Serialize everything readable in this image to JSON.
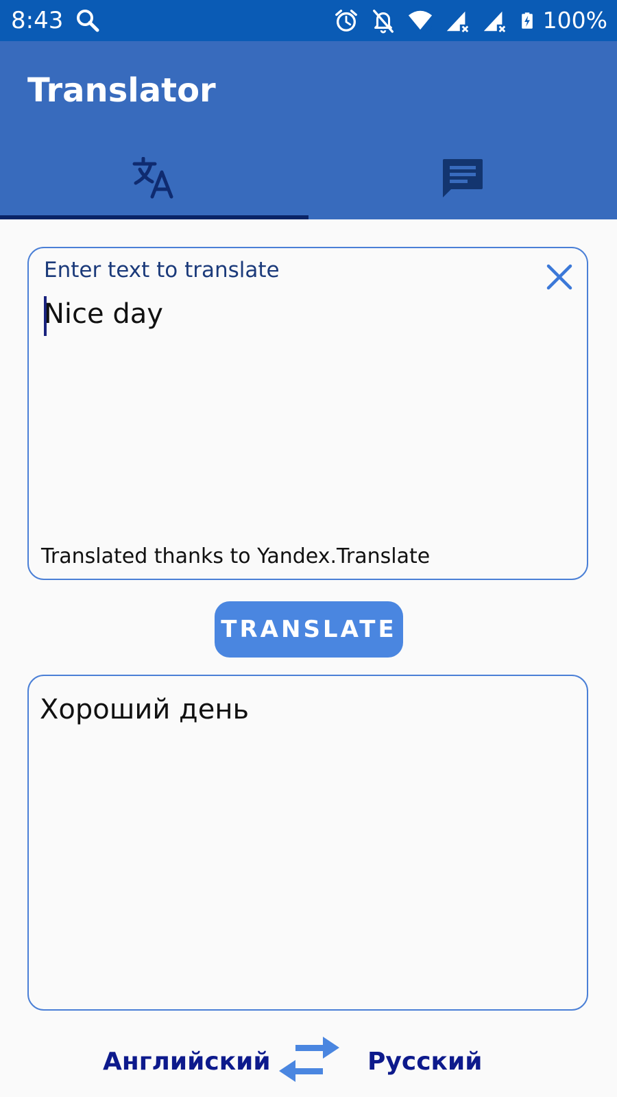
{
  "status_bar": {
    "time": "8:43",
    "battery_percent": "100%",
    "icons": [
      "search-icon",
      "alarm-icon",
      "notifications-off-icon",
      "wifi-icon",
      "signal-icon",
      "signal-icon",
      "battery-charging-icon"
    ]
  },
  "app_bar": {
    "title": "Translator"
  },
  "tabs": [
    {
      "icon": "translate-icon",
      "selected": true
    },
    {
      "icon": "chat-icon",
      "selected": false
    }
  ],
  "input": {
    "label": "Enter text to translate",
    "value": "Nice day",
    "credit": "Translated thanks to Yandex.Translate"
  },
  "translate_button": {
    "label": "TRANSLATE"
  },
  "output": {
    "value": "Хороший день"
  },
  "languages": {
    "source": "Английский",
    "target": "Русский"
  },
  "colors": {
    "status_bar": "#0a5bb5",
    "app_bar": "#386bbd",
    "accent": "#4a86e0",
    "tab_indicator": "#0a2466",
    "language_text": "#0d1a8c"
  }
}
